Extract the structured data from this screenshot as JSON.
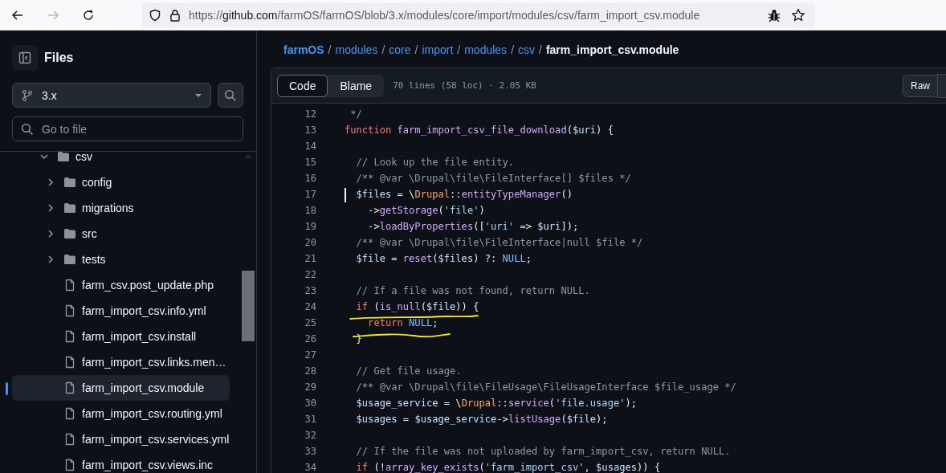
{
  "browser": {
    "back_disabled": false,
    "forward_disabled": true,
    "url": {
      "scheme": "https://",
      "host": "github.com",
      "path": "/farmOS/farmOS/blob/3.x/modules/core/import/modules/csv/farm_import_csv.module"
    }
  },
  "sidebar": {
    "title": "Files",
    "branch": "3.x",
    "search": {
      "placeholder": "Go to file"
    },
    "tree": [
      {
        "name": "csv",
        "kind": "folder",
        "expanded": true,
        "selected": false,
        "children": [
          {
            "name": "config",
            "kind": "folder",
            "expanded": false,
            "selected": false
          },
          {
            "name": "migrations",
            "kind": "folder",
            "expanded": false,
            "selected": false
          },
          {
            "name": "src",
            "kind": "folder",
            "expanded": false,
            "selected": false
          },
          {
            "name": "tests",
            "kind": "folder",
            "expanded": false,
            "selected": false
          },
          {
            "name": "farm_csv.post_update.php",
            "kind": "file",
            "selected": false
          },
          {
            "name": "farm_import_csv.info.yml",
            "kind": "file",
            "selected": false
          },
          {
            "name": "farm_import_csv.install",
            "kind": "file",
            "selected": false
          },
          {
            "name": "farm_import_csv.links.men…",
            "kind": "file",
            "selected": false
          },
          {
            "name": "farm_import_csv.module",
            "kind": "file",
            "selected": true
          },
          {
            "name": "farm_import_csv.routing.yml",
            "kind": "file",
            "selected": false
          },
          {
            "name": "farm_import_csv.services.yml",
            "kind": "file",
            "selected": false
          },
          {
            "name": "farm_import_csv.views.inc",
            "kind": "file",
            "selected": false
          }
        ]
      }
    ]
  },
  "breadcrumb": {
    "separator": "/",
    "items": [
      {
        "text": "farmOS",
        "current": false,
        "bold": true
      },
      {
        "text": "modules",
        "current": false,
        "bold": false
      },
      {
        "text": "core",
        "current": false,
        "bold": false
      },
      {
        "text": "import",
        "current": false,
        "bold": false
      },
      {
        "text": "modules",
        "current": false,
        "bold": false
      },
      {
        "text": "csv",
        "current": false,
        "bold": false
      },
      {
        "text": "farm_import_csv.module",
        "current": true,
        "bold": true
      }
    ]
  },
  "toolbar": {
    "tabs": [
      {
        "label": "Code",
        "selected": true
      },
      {
        "label": "Blame",
        "selected": false
      }
    ],
    "info": "70 lines (58 loc) · 2.05 KB",
    "buttons": [
      "Raw"
    ]
  },
  "code": {
    "lines": [
      {
        "number": "12",
        "cursor": false,
        "tokens": [
          {
            "kind": "comment",
            "text": " */"
          }
        ]
      },
      {
        "number": "13",
        "cursor": false,
        "tokens": [
          {
            "kind": "keyword",
            "text": "function "
          },
          {
            "kind": "function",
            "text": "farm_import_csv_file_download"
          },
          {
            "kind": "plain",
            "text": "("
          },
          {
            "kind": "variable",
            "text": "$uri"
          },
          {
            "kind": "plain",
            "text": ") {"
          }
        ]
      },
      {
        "number": "14",
        "cursor": false
      },
      {
        "number": "15",
        "cursor": false,
        "tokens": [
          {
            "kind": "comment",
            "text": "  // Look up the file entity."
          }
        ]
      },
      {
        "number": "16",
        "cursor": false,
        "tokens": [
          {
            "kind": "comment",
            "text": "  /** @var \\Drupal\\file\\FileInterface[] $files */"
          }
        ]
      },
      {
        "number": "17",
        "cursor": true,
        "tokens": [
          {
            "kind": "variable",
            "text": "  $files"
          },
          {
            "kind": "plain",
            "text": " = \\"
          },
          {
            "kind": "class",
            "text": "Drupal"
          },
          {
            "kind": "plain",
            "text": "::"
          },
          {
            "kind": "function",
            "text": "entityTypeManager"
          },
          {
            "kind": "plain",
            "text": "()"
          }
        ]
      },
      {
        "number": "18",
        "cursor": false,
        "tokens": [
          {
            "kind": "plain",
            "text": "    ->"
          },
          {
            "kind": "function",
            "text": "getStorage"
          },
          {
            "kind": "plain",
            "text": "("
          },
          {
            "kind": "string",
            "text": "'file'"
          },
          {
            "kind": "plain",
            "text": ")"
          }
        ]
      },
      {
        "number": "19",
        "cursor": false,
        "tokens": [
          {
            "kind": "plain",
            "text": "    ->"
          },
          {
            "kind": "function",
            "text": "loadByProperties"
          },
          {
            "kind": "plain",
            "text": "(["
          },
          {
            "kind": "string",
            "text": "'uri'"
          },
          {
            "kind": "plain",
            "text": " => "
          },
          {
            "kind": "variable",
            "text": "$uri"
          },
          {
            "kind": "plain",
            "text": "]);"
          }
        ]
      },
      {
        "number": "20",
        "cursor": false,
        "tokens": [
          {
            "kind": "comment",
            "text": "  /** @var \\Drupal\\file\\FileInterface|null $file */"
          }
        ]
      },
      {
        "number": "21",
        "cursor": false,
        "tokens": [
          {
            "kind": "variable",
            "text": "  $file"
          },
          {
            "kind": "plain",
            "text": " = "
          },
          {
            "kind": "function",
            "text": "reset"
          },
          {
            "kind": "plain",
            "text": "("
          },
          {
            "kind": "variable",
            "text": "$files"
          },
          {
            "kind": "plain",
            "text": ") ?: "
          },
          {
            "kind": "constant",
            "text": "NULL"
          },
          {
            "kind": "plain",
            "text": ";"
          }
        ]
      },
      {
        "number": "22",
        "cursor": false
      },
      {
        "number": "23",
        "cursor": false,
        "tokens": [
          {
            "kind": "comment",
            "text": "  // If a file was not found, return NULL."
          }
        ]
      },
      {
        "number": "24",
        "cursor": false,
        "tokens": [
          {
            "kind": "keyword",
            "text": "  if"
          },
          {
            "kind": "plain",
            "text": " ("
          },
          {
            "kind": "function",
            "text": "is_null"
          },
          {
            "kind": "plain",
            "text": "("
          },
          {
            "kind": "variable",
            "text": "$file"
          },
          {
            "kind": "plain",
            "text": ")) {"
          }
        ]
      },
      {
        "number": "25",
        "cursor": false,
        "tokens": [
          {
            "kind": "keyword",
            "text": "    return "
          },
          {
            "kind": "constant",
            "text": "NULL"
          },
          {
            "kind": "plain",
            "text": ";"
          }
        ]
      },
      {
        "number": "26",
        "cursor": false,
        "tokens": [
          {
            "kind": "plain",
            "text": "  }"
          }
        ]
      },
      {
        "number": "27",
        "cursor": false
      },
      {
        "number": "28",
        "cursor": false,
        "tokens": [
          {
            "kind": "comment",
            "text": "  // Get file usage."
          }
        ]
      },
      {
        "number": "29",
        "cursor": false,
        "tokens": [
          {
            "kind": "comment",
            "text": "  /** @var \\Drupal\\file\\FileUsage\\FileUsageInterface $file_usage */"
          }
        ]
      },
      {
        "number": "30",
        "cursor": false,
        "tokens": [
          {
            "kind": "variable",
            "text": "  $usage_service"
          },
          {
            "kind": "plain",
            "text": " = \\"
          },
          {
            "kind": "class",
            "text": "Drupal"
          },
          {
            "kind": "plain",
            "text": "::"
          },
          {
            "kind": "function",
            "text": "service"
          },
          {
            "kind": "plain",
            "text": "("
          },
          {
            "kind": "string",
            "text": "'file.usage'"
          },
          {
            "kind": "plain",
            "text": ");"
          }
        ]
      },
      {
        "number": "31",
        "cursor": false,
        "tokens": [
          {
            "kind": "variable",
            "text": "  $usages"
          },
          {
            "kind": "plain",
            "text": " = "
          },
          {
            "kind": "variable",
            "text": "$usage_service"
          },
          {
            "kind": "plain",
            "text": "->"
          },
          {
            "kind": "function",
            "text": "listUsage"
          },
          {
            "kind": "plain",
            "text": "("
          },
          {
            "kind": "variable",
            "text": "$file"
          },
          {
            "kind": "plain",
            "text": ");"
          }
        ]
      },
      {
        "number": "32",
        "cursor": false
      },
      {
        "number": "33",
        "cursor": false,
        "tokens": [
          {
            "kind": "comment",
            "text": "  // If the file was not uploaded by farm_import_csv, return NULL."
          }
        ]
      },
      {
        "number": "34",
        "cursor": false,
        "tokens": [
          {
            "kind": "keyword",
            "text": "  if"
          },
          {
            "kind": "plain",
            "text": " (!"
          },
          {
            "kind": "function",
            "text": "array_key_exists"
          },
          {
            "kind": "plain",
            "text": "("
          },
          {
            "kind": "string",
            "text": "'farm_import_csv'"
          },
          {
            "kind": "plain",
            "text": ", "
          },
          {
            "kind": "variable",
            "text": "$usages"
          },
          {
            "kind": "plain",
            "text": ")) {"
          }
        ]
      }
    ]
  }
}
